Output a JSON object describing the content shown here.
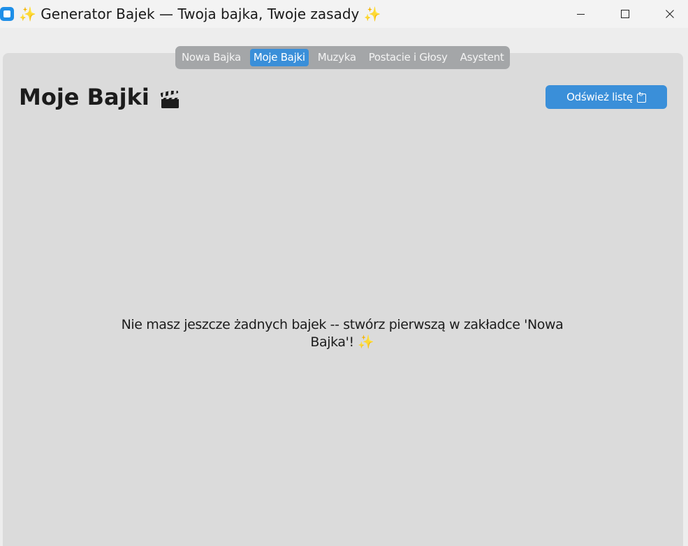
{
  "window": {
    "title": "✨ Generator Bajek — Twoja bajka, Twoje zasady ✨",
    "minimize_icon": "minimize-icon",
    "maximize_icon": "maximize-icon",
    "close_icon": "close-icon"
  },
  "tabs": [
    {
      "label": "Nowa Bajka",
      "active": false
    },
    {
      "label": "Moje Bajki",
      "active": true
    },
    {
      "label": "Muzyka",
      "active": false
    },
    {
      "label": "Postacie i Głosy",
      "active": false
    },
    {
      "label": "Asystent",
      "active": false
    }
  ],
  "header": {
    "title": "Moje Bajki",
    "title_icon": "clapperboard-icon",
    "refresh_label": "Odśwież listę",
    "refresh_icon": "refresh-icon"
  },
  "empty_state": {
    "message": "Nie masz jeszcze żadnych bajek -- stwórz pierwszą w zakładce 'Nowa Bajka'! ✨"
  },
  "colors": {
    "accent": "#3a8fd9",
    "panel": "#dbdbdb",
    "tab_bar": "#a4a6a8",
    "app_icon": "#1e8fe8"
  }
}
